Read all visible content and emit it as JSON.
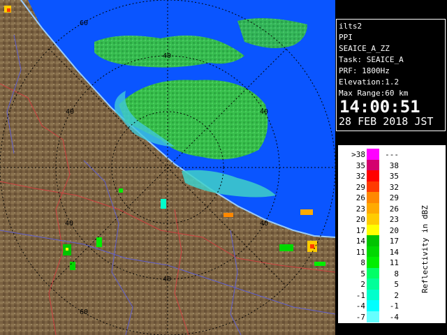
{
  "station": {
    "name": "ilts2",
    "mode": "PPI",
    "product": "SEAICE_A_ZZ",
    "task": "Task: SEAICE_A",
    "prf": "PRF: 1800Hz",
    "elevation": "Elevation:1.2",
    "max_range": "Max Range:60 km",
    "time": "14:00:51",
    "date": "28 FEB 2018 JST"
  },
  "range_rings": {
    "labels": [
      "60",
      "40",
      "40",
      "40",
      "40",
      "40",
      "60"
    ]
  },
  "legend": {
    "unit": "Reflectivity in dBZ",
    "rows": [
      {
        "low": ">38",
        "high": "---",
        "color": "#ff00ff"
      },
      {
        "low": "35",
        "high": "38",
        "color": "#d4006e"
      },
      {
        "low": "32",
        "high": "35",
        "color": "#ff0000"
      },
      {
        "low": "29",
        "high": "32",
        "color": "#ff3a00"
      },
      {
        "low": "26",
        "high": "29",
        "color": "#ff8800"
      },
      {
        "low": "23",
        "high": "26",
        "color": "#ffaa00"
      },
      {
        "low": "20",
        "high": "23",
        "color": "#ffcc00"
      },
      {
        "low": "17",
        "high": "20",
        "color": "#ffff00"
      },
      {
        "low": "14",
        "high": "17",
        "color": "#00c400"
      },
      {
        "low": "11",
        "high": "14",
        "color": "#00d800"
      },
      {
        "low": "8",
        "high": "11",
        "color": "#00ee00"
      },
      {
        "low": "5",
        "high": "8",
        "color": "#00ff66"
      },
      {
        "low": "2",
        "high": "5",
        "color": "#00ff99"
      },
      {
        "low": "-1",
        "high": "2",
        "color": "#00ffcc"
      },
      {
        "low": "-4",
        "high": "-1",
        "color": "#00ffff"
      },
      {
        "low": "-7",
        "high": "-4",
        "color": "#66ffff"
      }
    ]
  },
  "colors": {
    "sea": "#0a55ff",
    "land": "#7a6040",
    "rings": "#000000"
  }
}
